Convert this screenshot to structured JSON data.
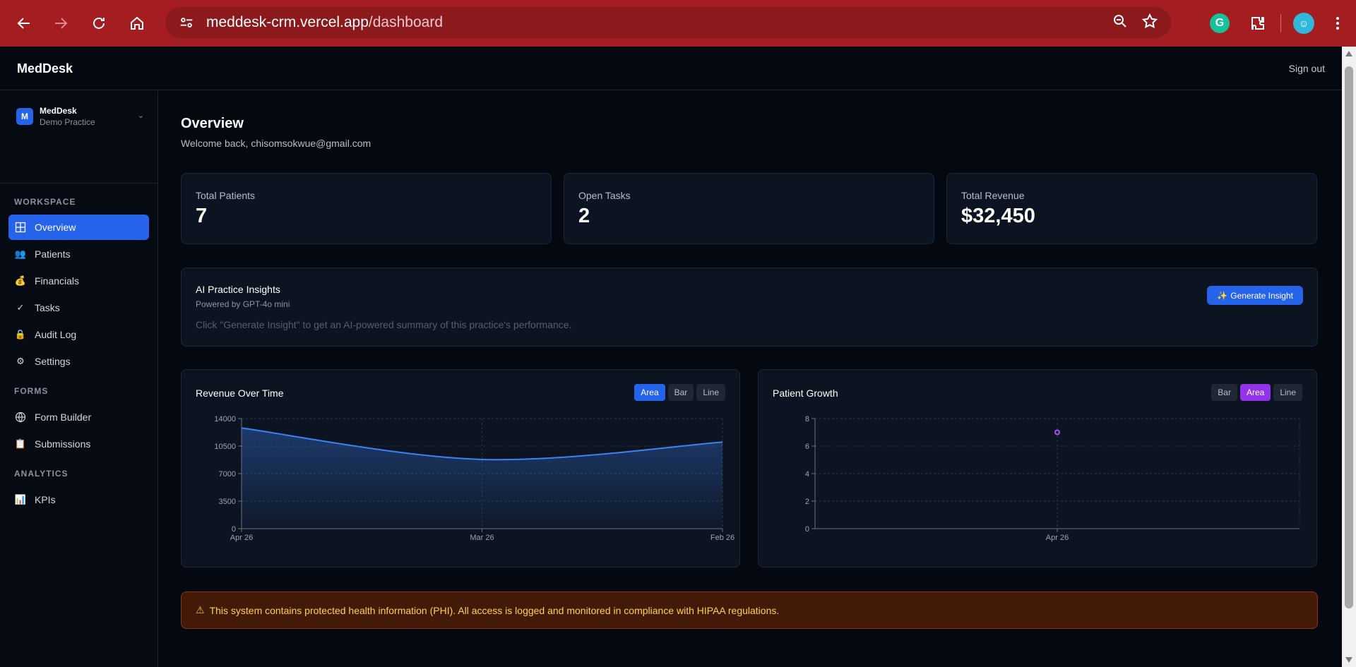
{
  "browser": {
    "url_host": "meddesk-crm.vercel.app",
    "url_path": "/dashboard"
  },
  "app": {
    "brand": "MedDesk",
    "sign_out": "Sign out"
  },
  "org": {
    "badge": "M",
    "name": "MedDesk",
    "subtitle": "Demo Practice"
  },
  "sidebar": {
    "sections": [
      {
        "label": "WORKSPACE"
      },
      {
        "label": "FORMS"
      },
      {
        "label": "ANALYTICS"
      }
    ],
    "items": [
      {
        "label": "Overview",
        "icon": "grid-icon",
        "active": true
      },
      {
        "label": "Patients",
        "icon": "people-icon"
      },
      {
        "label": "Financials",
        "icon": "money-bag-icon"
      },
      {
        "label": "Tasks",
        "icon": "check-icon"
      },
      {
        "label": "Audit Log",
        "icon": "lock-icon"
      },
      {
        "label": "Settings",
        "icon": "gear-icon"
      },
      {
        "label": "Form Builder",
        "icon": "globe-icon"
      },
      {
        "label": "Submissions",
        "icon": "clipboard-icon"
      },
      {
        "label": "KPIs",
        "icon": "bar-chart-icon"
      }
    ]
  },
  "overview": {
    "title": "Overview",
    "welcome": "Welcome back, chisomsokwue@gmail.com"
  },
  "stats": [
    {
      "label": "Total Patients",
      "value": "7"
    },
    {
      "label": "Open Tasks",
      "value": "2"
    },
    {
      "label": "Total Revenue",
      "value": "$32,450"
    }
  ],
  "ai": {
    "title": "AI Practice Insights",
    "subtitle": "Powered by GPT-4o mini",
    "hint": "Click \"Generate Insight\" to get an AI-powered summary of this practice's performance.",
    "button_icon": "✨",
    "button_label": "Generate Insight"
  },
  "charts": {
    "revenue": {
      "title": "Revenue Over Time",
      "toggles": [
        "Area",
        "Bar",
        "Line"
      ],
      "active": "Area"
    },
    "patients": {
      "title": "Patient Growth",
      "toggles": [
        "Bar",
        "Area",
        "Line"
      ],
      "active": "Area"
    }
  },
  "chart_data": [
    {
      "type": "area",
      "title": "Revenue Over Time",
      "categories": [
        "Apr 26",
        "Mar 26",
        "Feb 26"
      ],
      "series": [
        {
          "values": [
            12800,
            8800,
            11000
          ]
        }
      ],
      "yticks": [
        0,
        3500,
        7000,
        10500,
        14000
      ],
      "ylim": [
        0,
        14000
      ],
      "grid": true,
      "color": "#3b82f6"
    },
    {
      "type": "scatter",
      "title": "Patient Growth",
      "categories": [
        "Apr 26"
      ],
      "series": [
        {
          "values": [
            7
          ]
        }
      ],
      "yticks": [
        0,
        2,
        4,
        6,
        8
      ],
      "ylim": [
        0,
        8
      ],
      "grid": true,
      "color": "#a855f7"
    }
  ],
  "notice": {
    "icon": "⚠",
    "text": "This system contains protected health information (PHI). All access is logged and monitored in compliance with HIPAA regulations."
  }
}
